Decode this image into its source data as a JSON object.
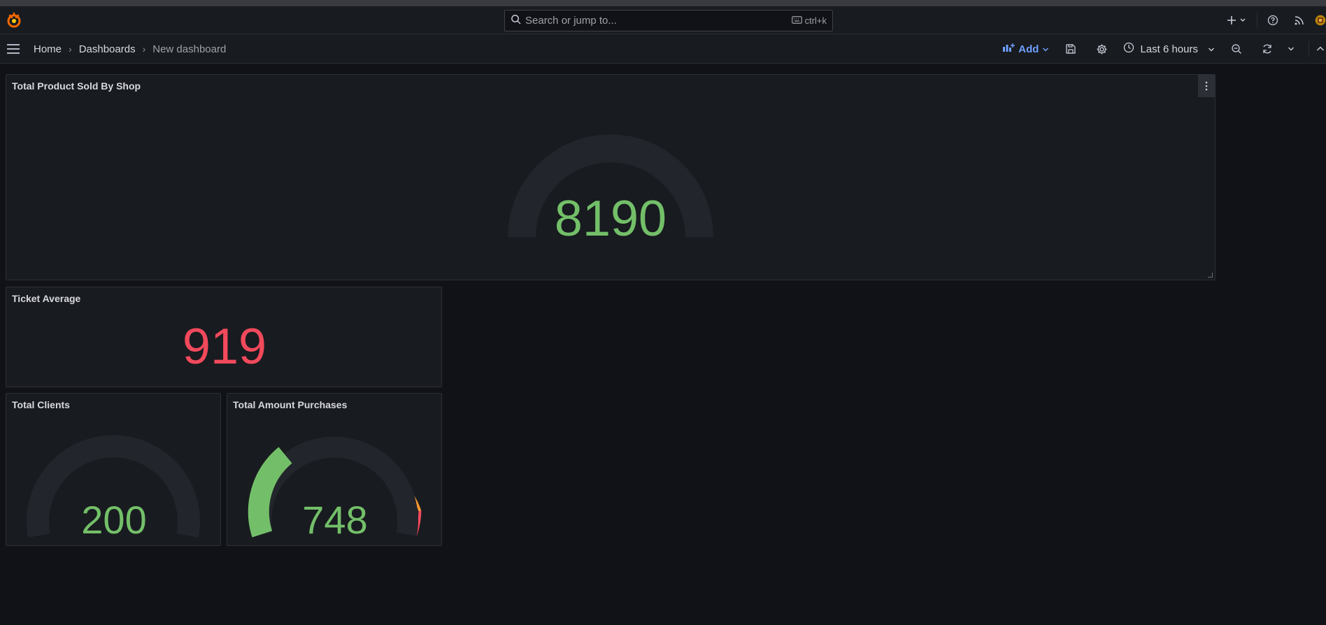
{
  "topbar": {
    "search_placeholder": "Search or jump to...",
    "search_shortcut": "ctrl+k"
  },
  "breadcrumb": {
    "home": "Home",
    "dashboards": "Dashboards",
    "current": "New dashboard"
  },
  "toolbar": {
    "add_label": "Add",
    "time_range": "Last 6 hours"
  },
  "colors": {
    "green": "#73bf69",
    "red": "#f2495c",
    "orange": "#ff9830",
    "track": "#22252b",
    "accent": "#6e9fff"
  },
  "panels": {
    "total_product": {
      "title": "Total Product Sold By Shop",
      "value": "8190"
    },
    "ticket_average": {
      "title": "Ticket Average",
      "value": "919"
    },
    "total_clients": {
      "title": "Total Clients",
      "value": "200"
    },
    "total_amount": {
      "title": "Total Amount Purchases",
      "value": "748"
    }
  }
}
